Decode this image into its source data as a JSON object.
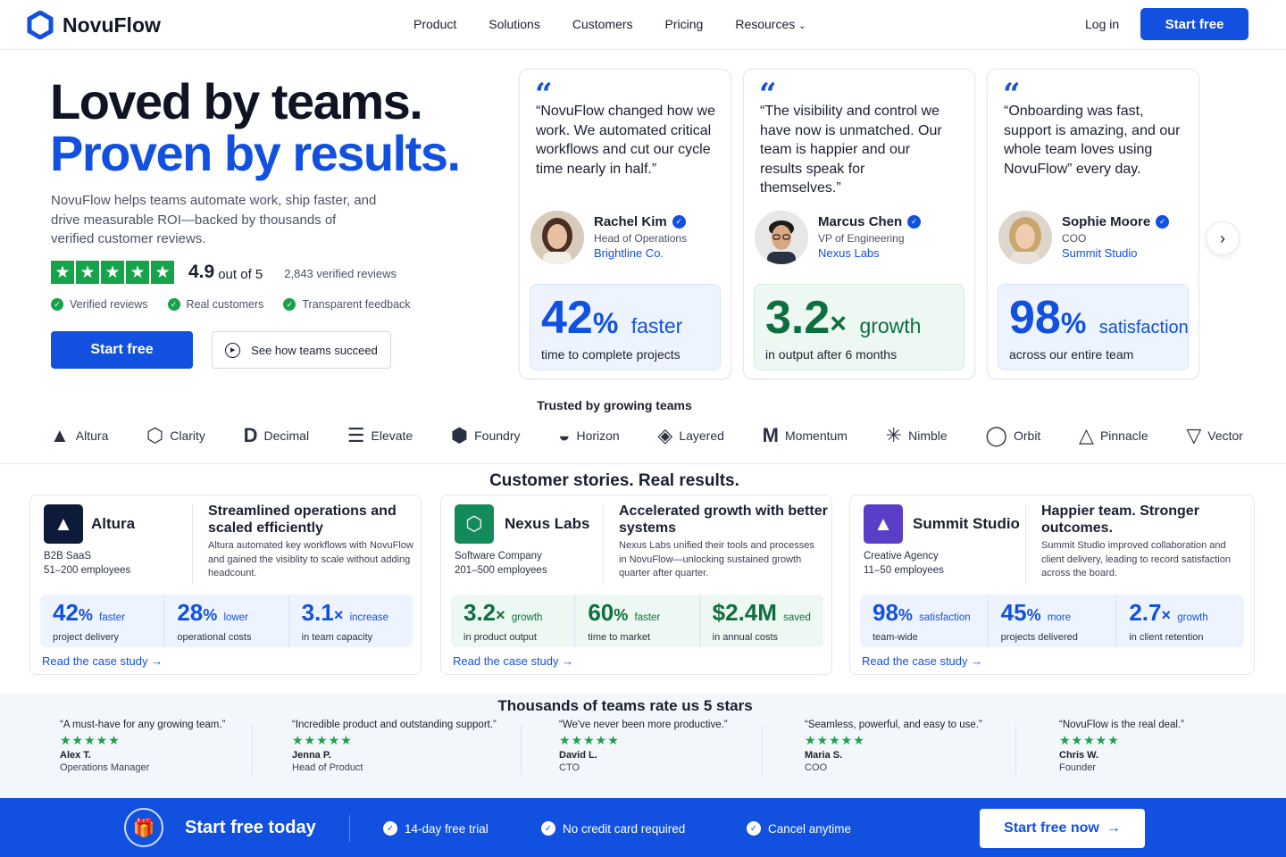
{
  "brand": {
    "name": "NovuFlow",
    "accent": "#1250e0",
    "green": "#16a34a"
  },
  "nav": {
    "links": [
      "Product",
      "Solutions",
      "Customers",
      "Pricing",
      "Resources"
    ],
    "login": "Log in",
    "cta": "Start free"
  },
  "hero": {
    "title_line1": "Loved by teams.",
    "title_line2": "Proven by results.",
    "description": "NovuFlow helps teams automate work, ship faster, and drive measurable ROI—backed by thousands of verified customer reviews.",
    "rating": "4.9",
    "rating_of": "out of 5",
    "review_count": "2,843 verified reviews",
    "stars": 5,
    "checks": [
      "Verified reviews",
      "Real customers",
      "Transparent feedback"
    ],
    "primary_cta": "Start free",
    "secondary_cta": "See how teams succeed"
  },
  "testimonials": [
    {
      "quote": "“NovuFlow changed how we work. We automated critical workflows and cut our cycle time nearly in half.”",
      "name": "Rachel Kim",
      "role": "Head of Operations",
      "company": "Brightline Co.",
      "stat_value": "42",
      "stat_unit": "%",
      "stat_word": "faster",
      "stat_label": "time to complete projects"
    },
    {
      "quote": "“The visibility and control we have now is unmatched. Our team is happier and our results speak for themselves.”",
      "name": "Marcus Chen",
      "role": "VP of Engineering",
      "company": "Nexus Labs",
      "stat_value": "3.2",
      "stat_unit": "×",
      "stat_word": "growth",
      "stat_label": "in output after 6 months"
    },
    {
      "quote": "“Onboarding was fast, support is amazing, and our whole team loves using NovuFlow” every day.",
      "name": "Sophie Moore",
      "role": "COO",
      "company": "Summit Studio",
      "stat_value": "98",
      "stat_unit": "%",
      "stat_word": "satisfaction",
      "stat_label": "across our entire team"
    }
  ],
  "trusted": {
    "title": "Trusted by growing teams",
    "logos": [
      "Altura",
      "Clarity",
      "Decimal",
      "Elevate",
      "Foundry",
      "Horizon",
      "Layered",
      "Momentum",
      "Nimble",
      "Orbit",
      "Pinnacle",
      "Vector"
    ]
  },
  "cases": {
    "title": "Customer stories. Real results.",
    "link": "Read the case study",
    "items": [
      {
        "name": "Altura",
        "industry": "B2B SaaS",
        "size": "51–200 employees",
        "headline": "Streamlined operations and scaled efficiently",
        "desc": "Altura automated key workflows with NovuFlow and gained the visiblity to scale without adding headcount.",
        "color": "#0e1a3a",
        "stats": [
          {
            "v": "42",
            "u": "%",
            "w": "faster",
            "l": "project delivery"
          },
          {
            "v": "28",
            "u": "%",
            "w": "lower",
            "l": "operational costs"
          },
          {
            "v": "3.1",
            "u": "×",
            "w": "increase",
            "l": "in team capacity"
          }
        ]
      },
      {
        "name": "Nexus Labs",
        "industry": "Software Company",
        "size": "201–500 employees",
        "headline": "Accelerated growth with better systems",
        "desc": "Nexus Labs unified their tools and processes in NovuFlow—unlocking sustained growth quarter after quarter.",
        "color": "#138a5a",
        "stats": [
          {
            "v": "3.2",
            "u": "×",
            "w": "growth",
            "l": "in product output"
          },
          {
            "v": "60",
            "u": "%",
            "w": "faster",
            "l": "time to market"
          },
          {
            "v": "$2.4M",
            "u": "",
            "w": "saved",
            "l": "in annual costs"
          }
        ]
      },
      {
        "name": "Summit Studio",
        "industry": "Creative Agency",
        "size": "11–50 employees",
        "headline": "Happier team. Stronger outcomes.",
        "desc": "Summit Studio improved collaboration and client delivery, leading to record satisfaction across the board.",
        "color": "#5b3ec8",
        "stats": [
          {
            "v": "98",
            "u": "%",
            "w": "satisfaction",
            "l": "team-wide"
          },
          {
            "v": "45",
            "u": "%",
            "w": "more",
            "l": "projects delivered"
          },
          {
            "v": "2.7",
            "u": "×",
            "w": "growth",
            "l": "in client retention"
          }
        ]
      }
    ]
  },
  "reviews": {
    "title": "Thousands of teams rate us 5 stars",
    "items": [
      {
        "quote": "“A must-have for any growing team.”",
        "name": "Alex T.",
        "role": "Operations Manager"
      },
      {
        "quote": "“Incredible product and outstanding support.”",
        "name": "Jenna P.",
        "role": "Head of Product"
      },
      {
        "quote": "“We've never been more productive.”",
        "name": "David L.",
        "role": "CTO"
      },
      {
        "quote": "“Seamless, powerful, and easy to use.”",
        "name": "Maria S.",
        "role": "COO"
      },
      {
        "quote": "“NovuFlow is the real deal.”",
        "name": "Chris W.",
        "role": "Founder"
      }
    ]
  },
  "cta_bar": {
    "title": "Start free today",
    "items": [
      "14-day free trial",
      "No credit card required",
      "Cancel anytime"
    ],
    "button": "Start free now"
  }
}
